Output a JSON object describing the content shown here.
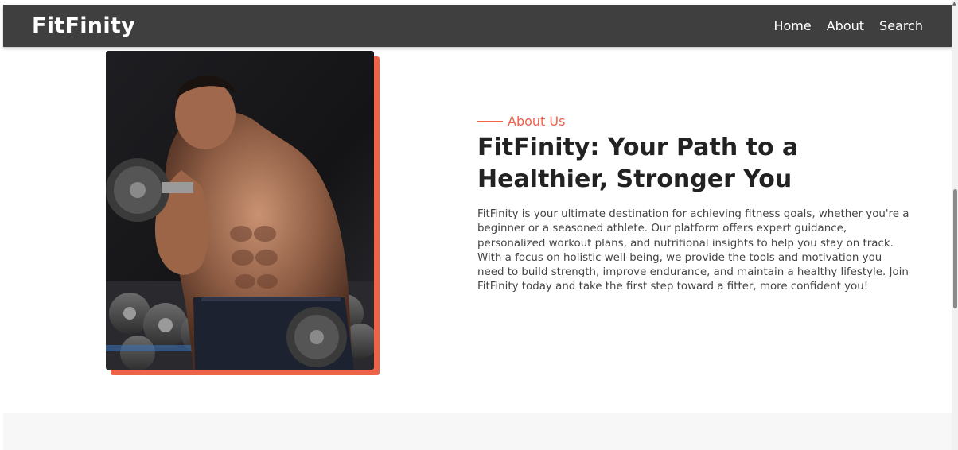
{
  "navbar": {
    "brand": "FitFinity",
    "links": [
      {
        "label": "Home"
      },
      {
        "label": "About"
      },
      {
        "label": "Search"
      }
    ]
  },
  "about": {
    "eyebrow": "About Us",
    "title": "FitFinity: Your Path to a Healthier, Stronger You",
    "body": "FitFinity is your ultimate destination for achieving fitness goals, whether you're a beginner or a seasoned athlete. Our platform offers expert guidance, personalized workout plans, and nutritional insights to help you stay on track. With a focus on holistic well-being, we provide the tools and motivation you need to build strength, improve endurance, and maintain a healthy lifestyle. Join FitFinity today and take the first step toward a fitter, more confident you!"
  },
  "colors": {
    "navbar_bg": "#3f3f3f",
    "accent": "#f0614a",
    "title": "#222222",
    "body": "#444444"
  }
}
